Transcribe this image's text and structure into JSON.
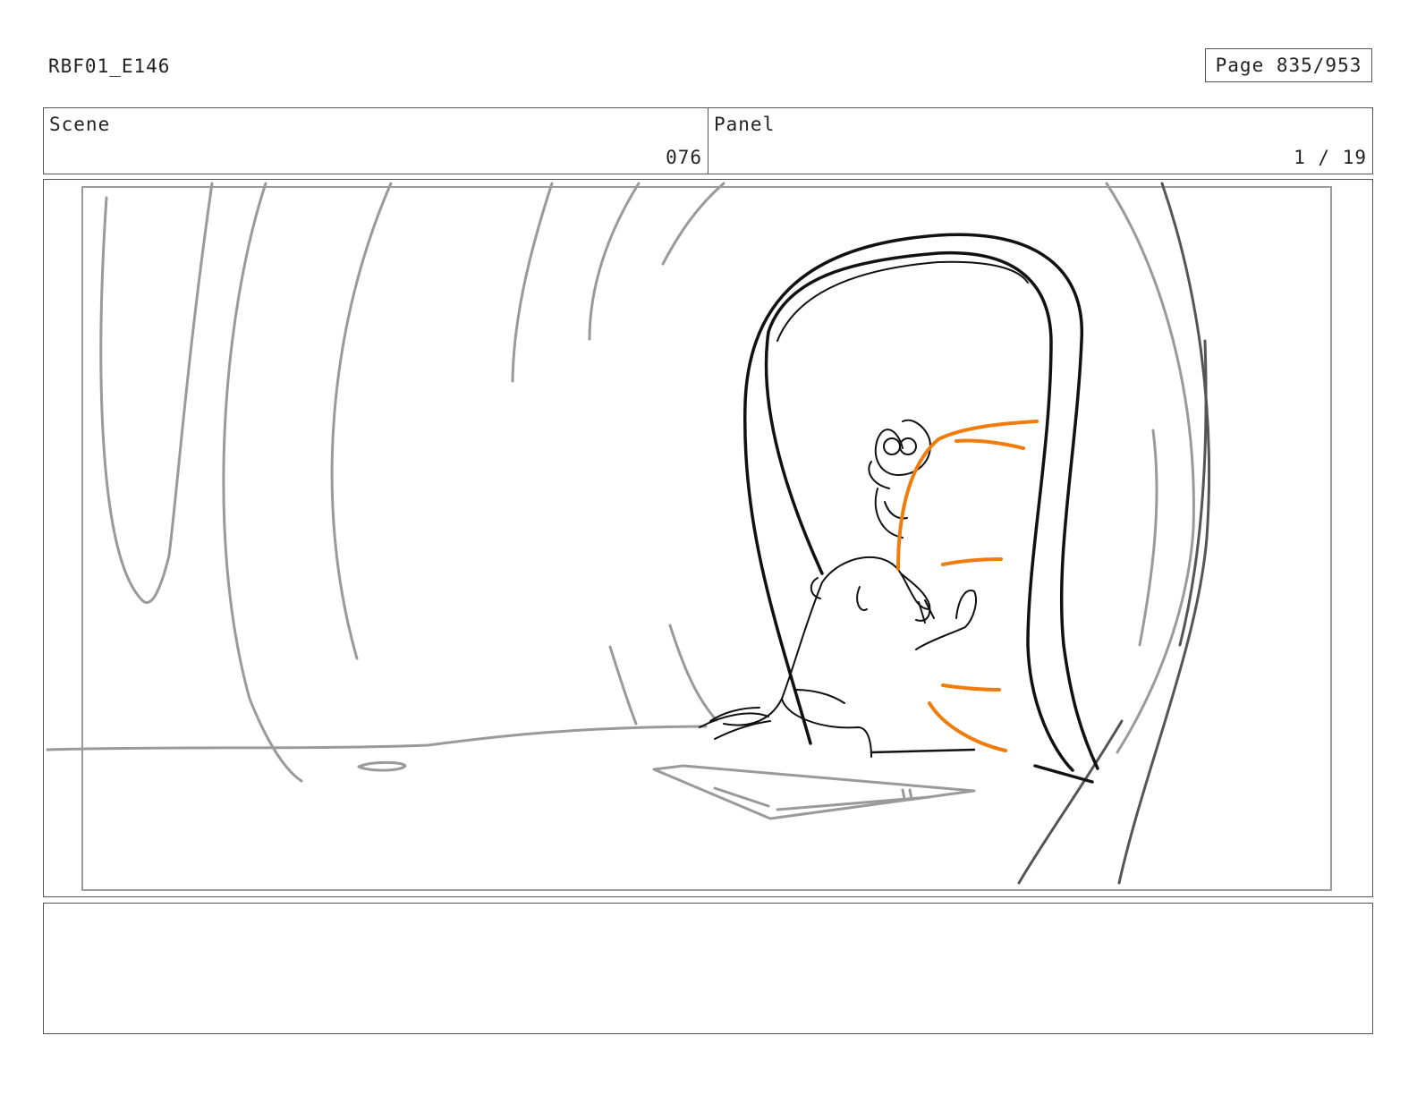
{
  "header": {
    "project_code": "RBF01_E146",
    "page_label": "Page 835/953"
  },
  "info": {
    "scene_label": "Scene",
    "scene_value": "076",
    "panel_label": "Panel",
    "panel_value": "1 / 19"
  },
  "colors": {
    "sketch_gray": "#9a9a9a",
    "sketch_dark": "#555555",
    "ink": "#111111",
    "accent_orange": "#f07c0c"
  },
  "notes": {
    "text": ""
  }
}
